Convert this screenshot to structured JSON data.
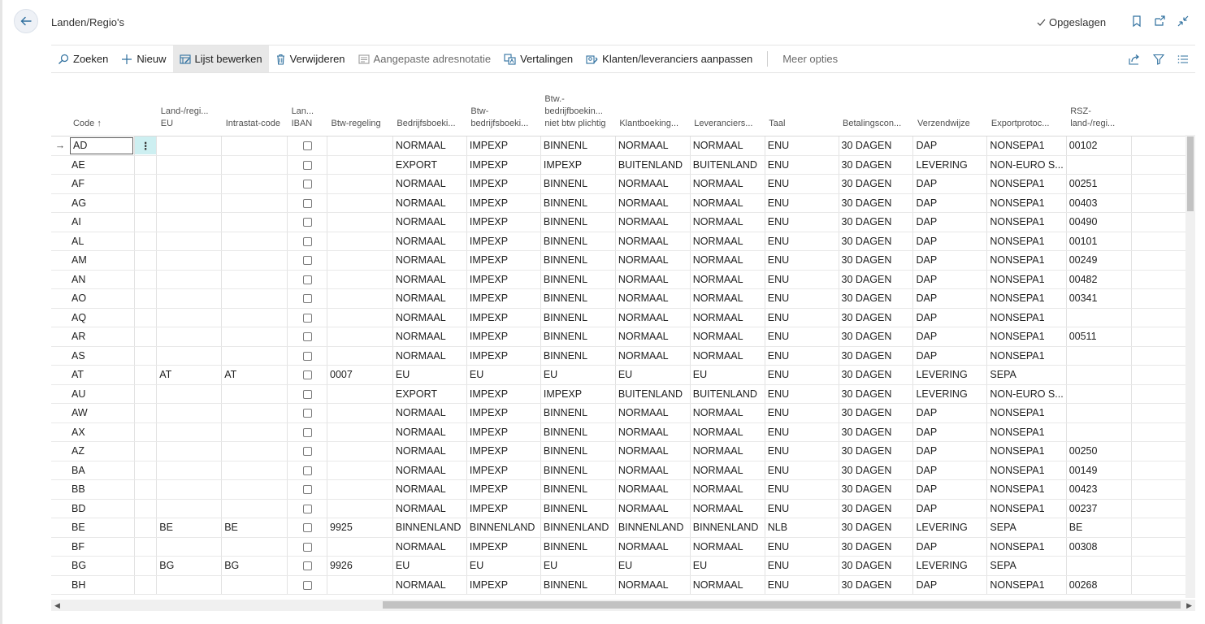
{
  "header": {
    "title": "Landen/Regio's",
    "saved_label": "Opgeslagen"
  },
  "actions": {
    "search": "Zoeken",
    "new": "Nieuw",
    "edit_list": "Lijst bewerken",
    "delete": "Verwijderen",
    "custom_address": "Aangepaste adresnotatie",
    "translations": "Vertalingen",
    "customers_vendors": "Klanten/leveranciers aanpassen",
    "more": "Meer opties"
  },
  "columns": [
    {
      "key": "code",
      "label": "Code ↑"
    },
    {
      "key": "land_eu",
      "label": "Land-/regi... EU"
    },
    {
      "key": "intrastat",
      "label": "Intrastat-code"
    },
    {
      "key": "iban",
      "label": "Lan... IBAN"
    },
    {
      "key": "btw_regeling",
      "label": "Btw-regeling"
    },
    {
      "key": "bedrijf",
      "label": "Bedrijfsboeki..."
    },
    {
      "key": "btw_bedrijf",
      "label": "Btw-bedrijfsboeki..."
    },
    {
      "key": "btw_niet",
      "label": "Btw.-bedrijfboekin... niet btw plichtig"
    },
    {
      "key": "klant",
      "label": "Klantboeking..."
    },
    {
      "key": "leverancier",
      "label": "Leveranciers..."
    },
    {
      "key": "taal",
      "label": "Taal"
    },
    {
      "key": "betaling",
      "label": "Betalingscon..."
    },
    {
      "key": "verzend",
      "label": "Verzendwijze"
    },
    {
      "key": "export",
      "label": "Exportprotoc..."
    },
    {
      "key": "rsz",
      "label": "RSZ-land-/regi..."
    }
  ],
  "rows": [
    [
      "AD",
      "",
      "",
      "",
      "",
      "NORMAAL",
      "IMPEXP",
      "BINNENL",
      "NORMAAL",
      "NORMAAL",
      "ENU",
      "30 DAGEN",
      "DAP",
      "NONSEPA1",
      "00102"
    ],
    [
      "AE",
      "",
      "",
      "",
      "",
      "EXPORT",
      "IMPEXP",
      "IMPEXP",
      "BUITENLAND",
      "BUITENLAND",
      "ENU",
      "30 DAGEN",
      "LEVERING",
      "NON-EURO S...",
      ""
    ],
    [
      "AF",
      "",
      "",
      "",
      "",
      "NORMAAL",
      "IMPEXP",
      "BINNENL",
      "NORMAAL",
      "NORMAAL",
      "ENU",
      "30 DAGEN",
      "DAP",
      "NONSEPA1",
      "00251"
    ],
    [
      "AG",
      "",
      "",
      "",
      "",
      "NORMAAL",
      "IMPEXP",
      "BINNENL",
      "NORMAAL",
      "NORMAAL",
      "ENU",
      "30 DAGEN",
      "DAP",
      "NONSEPA1",
      "00403"
    ],
    [
      "AI",
      "",
      "",
      "",
      "",
      "NORMAAL",
      "IMPEXP",
      "BINNENL",
      "NORMAAL",
      "NORMAAL",
      "ENU",
      "30 DAGEN",
      "DAP",
      "NONSEPA1",
      "00490"
    ],
    [
      "AL",
      "",
      "",
      "",
      "",
      "NORMAAL",
      "IMPEXP",
      "BINNENL",
      "NORMAAL",
      "NORMAAL",
      "ENU",
      "30 DAGEN",
      "DAP",
      "NONSEPA1",
      "00101"
    ],
    [
      "AM",
      "",
      "",
      "",
      "",
      "NORMAAL",
      "IMPEXP",
      "BINNENL",
      "NORMAAL",
      "NORMAAL",
      "ENU",
      "30 DAGEN",
      "DAP",
      "NONSEPA1",
      "00249"
    ],
    [
      "AN",
      "",
      "",
      "",
      "",
      "NORMAAL",
      "IMPEXP",
      "BINNENL",
      "NORMAAL",
      "NORMAAL",
      "ENU",
      "30 DAGEN",
      "DAP",
      "NONSEPA1",
      "00482"
    ],
    [
      "AO",
      "",
      "",
      "",
      "",
      "NORMAAL",
      "IMPEXP",
      "BINNENL",
      "NORMAAL",
      "NORMAAL",
      "ENU",
      "30 DAGEN",
      "DAP",
      "NONSEPA1",
      "00341"
    ],
    [
      "AQ",
      "",
      "",
      "",
      "",
      "NORMAAL",
      "IMPEXP",
      "BINNENL",
      "NORMAAL",
      "NORMAAL",
      "ENU",
      "30 DAGEN",
      "DAP",
      "NONSEPA1",
      ""
    ],
    [
      "AR",
      "",
      "",
      "",
      "",
      "NORMAAL",
      "IMPEXP",
      "BINNENL",
      "NORMAAL",
      "NORMAAL",
      "ENU",
      "30 DAGEN",
      "DAP",
      "NONSEPA1",
      "00511"
    ],
    [
      "AS",
      "",
      "",
      "",
      "",
      "NORMAAL",
      "IMPEXP",
      "BINNENL",
      "NORMAAL",
      "NORMAAL",
      "ENU",
      "30 DAGEN",
      "DAP",
      "NONSEPA1",
      ""
    ],
    [
      "AT",
      "AT",
      "AT",
      "",
      "0007",
      "EU",
      "EU",
      "EU",
      "EU",
      "EU",
      "ENU",
      "30 DAGEN",
      "LEVERING",
      "SEPA",
      ""
    ],
    [
      "AU",
      "",
      "",
      "",
      "",
      "EXPORT",
      "IMPEXP",
      "IMPEXP",
      "BUITENLAND",
      "BUITENLAND",
      "ENU",
      "30 DAGEN",
      "LEVERING",
      "NON-EURO S...",
      ""
    ],
    [
      "AW",
      "",
      "",
      "",
      "",
      "NORMAAL",
      "IMPEXP",
      "BINNENL",
      "NORMAAL",
      "NORMAAL",
      "ENU",
      "30 DAGEN",
      "DAP",
      "NONSEPA1",
      ""
    ],
    [
      "AX",
      "",
      "",
      "",
      "",
      "NORMAAL",
      "IMPEXP",
      "BINNENL",
      "NORMAAL",
      "NORMAAL",
      "ENU",
      "30 DAGEN",
      "DAP",
      "NONSEPA1",
      ""
    ],
    [
      "AZ",
      "",
      "",
      "",
      "",
      "NORMAAL",
      "IMPEXP",
      "BINNENL",
      "NORMAAL",
      "NORMAAL",
      "ENU",
      "30 DAGEN",
      "DAP",
      "NONSEPA1",
      "00250"
    ],
    [
      "BA",
      "",
      "",
      "",
      "",
      "NORMAAL",
      "IMPEXP",
      "BINNENL",
      "NORMAAL",
      "NORMAAL",
      "ENU",
      "30 DAGEN",
      "DAP",
      "NONSEPA1",
      "00149"
    ],
    [
      "BB",
      "",
      "",
      "",
      "",
      "NORMAAL",
      "IMPEXP",
      "BINNENL",
      "NORMAAL",
      "NORMAAL",
      "ENU",
      "30 DAGEN",
      "DAP",
      "NONSEPA1",
      "00423"
    ],
    [
      "BD",
      "",
      "",
      "",
      "",
      "NORMAAL",
      "IMPEXP",
      "BINNENL",
      "NORMAAL",
      "NORMAAL",
      "ENU",
      "30 DAGEN",
      "DAP",
      "NONSEPA1",
      "00237"
    ],
    [
      "BE",
      "BE",
      "BE",
      "",
      "9925",
      "BINNENLAND",
      "BINNENLAND",
      "BINNENLAND",
      "BINNENLAND",
      "BINNENLAND",
      "NLB",
      "30 DAGEN",
      "LEVERING",
      "SEPA",
      "BE"
    ],
    [
      "BF",
      "",
      "",
      "",
      "",
      "NORMAAL",
      "IMPEXP",
      "BINNENL",
      "NORMAAL",
      "NORMAAL",
      "ENU",
      "30 DAGEN",
      "DAP",
      "NONSEPA1",
      "00308"
    ],
    [
      "BG",
      "BG",
      "BG",
      "",
      "9926",
      "EU",
      "EU",
      "EU",
      "EU",
      "EU",
      "ENU",
      "30 DAGEN",
      "LEVERING",
      "SEPA",
      ""
    ],
    [
      "BH",
      "",
      "",
      "",
      "",
      "NORMAAL",
      "IMPEXP",
      "BINNENL",
      "NORMAAL",
      "NORMAAL",
      "ENU",
      "30 DAGEN",
      "DAP",
      "NONSEPA1",
      "00268"
    ]
  ],
  "colors": {
    "accent": "#2e7a8c",
    "selected_dots_bg": "#cdeff1",
    "active_action_bg": "#e8e8e8"
  }
}
